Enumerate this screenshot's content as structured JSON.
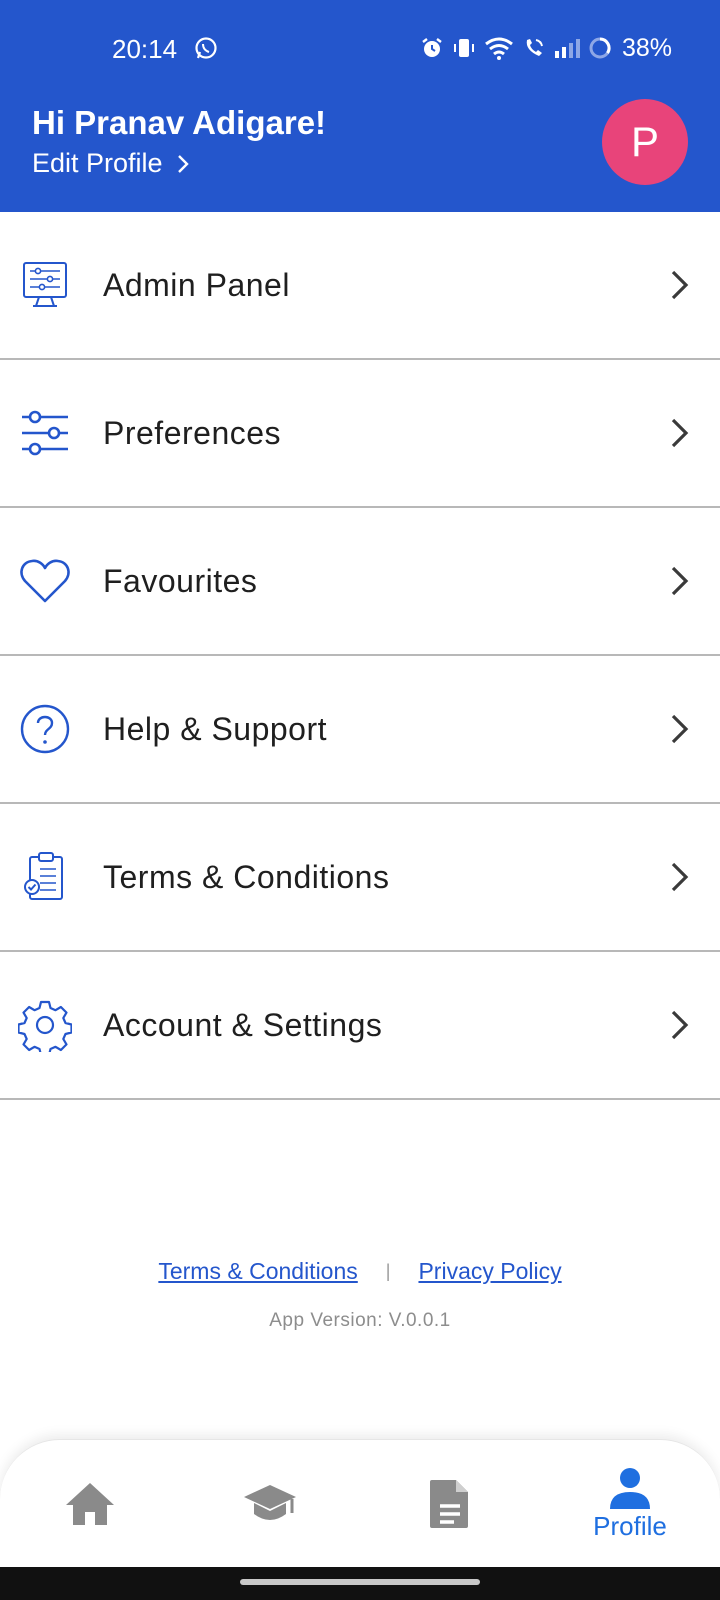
{
  "status_bar": {
    "time": "20:14",
    "battery": "38%"
  },
  "header": {
    "greeting": "Hi Pranav Adigare!",
    "edit_profile": "Edit Profile",
    "avatar_letter": "P",
    "background_color": "#2456cc",
    "avatar_color": "#e8447a"
  },
  "menu": {
    "items": [
      {
        "label": "Admin Panel",
        "icon": "admin-panel-icon"
      },
      {
        "label": "Preferences",
        "icon": "sliders-icon"
      },
      {
        "label": "Favourites",
        "icon": "heart-icon"
      },
      {
        "label": "Help & Support",
        "icon": "help-circle-icon"
      },
      {
        "label": "Terms & Conditions",
        "icon": "clipboard-check-icon"
      },
      {
        "label": "Account & Settings",
        "icon": "gear-icon"
      }
    ]
  },
  "footer": {
    "terms_link": "Terms & Conditions",
    "separator": "|",
    "privacy_link": "Privacy Policy",
    "app_version": "App Version: V.0.0.1"
  },
  "bottom_nav": {
    "items": [
      {
        "icon": "home-icon",
        "label": "",
        "active": false
      },
      {
        "icon": "graduation-cap-icon",
        "label": "",
        "active": false
      },
      {
        "icon": "document-icon",
        "label": "",
        "active": false
      },
      {
        "icon": "person-icon",
        "label": "Profile",
        "active": true
      }
    ],
    "active_color": "#1f6fe0",
    "inactive_color": "#8a8a8a"
  }
}
